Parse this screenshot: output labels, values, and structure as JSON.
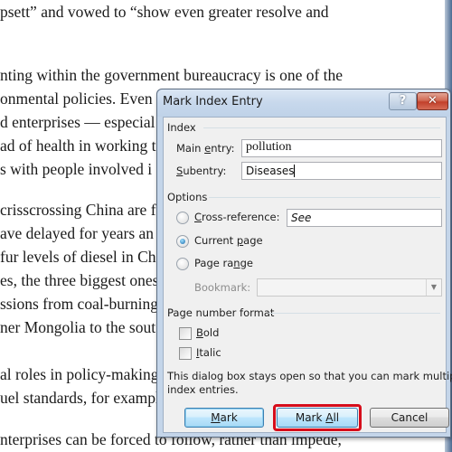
{
  "document": {
    "lines": [
      "psett” and vowed to “show even greater resolve and",
      "nting within the government bureaucracy is one of the",
      "onmental policies. Even",
      "d enterprises — especial",
      "ad of health in working t",
      "s with people involved i",
      "crisscrossing China are f",
      "ave delayed for years an",
      "fur levels of diesel in Ch",
      "es, the three biggest ones",
      "ssions from coal-burning",
      "ner Mongolia to the sout",
      "al roles in policy-making",
      "uel standards, for exampl",
      "nterprises can be forced to follow, rather than impede,"
    ]
  },
  "dialog": {
    "title": "Mark Index Entry",
    "help_button": "?",
    "close_button": "✕",
    "index_group": "Index",
    "main_entry": {
      "label_pre": "Main ",
      "label_key": "e",
      "label_post": "ntry:",
      "value": "pollution"
    },
    "subentry": {
      "label_key": "S",
      "label_post": "ubentry:",
      "value": "Diseases"
    },
    "options_group": "Options",
    "cross_reference": {
      "label_key": "C",
      "label_post": "ross-reference:",
      "value": "See",
      "selected": false
    },
    "current_page": {
      "label_pre": "Current ",
      "label_key": "p",
      "label_post": "age",
      "selected": true
    },
    "page_range": {
      "label_pre": "Page ra",
      "label_key": "n",
      "label_post": "ge",
      "selected": false
    },
    "bookmark": {
      "label": "Bookmark:",
      "value": "",
      "enabled": false
    },
    "format_group": "Page number format",
    "bold": {
      "label_key": "B",
      "label_post": "old",
      "checked": false
    },
    "italic": {
      "label_key": "I",
      "label_post": "talic",
      "checked": false
    },
    "info_text_1": "This dialog box stays open so that you can mark multiple",
    "info_text_2": "index entries.",
    "buttons": {
      "mark": {
        "label_key": "M",
        "label_post": "ark"
      },
      "mark_all": {
        "label_pre": "Mark ",
        "label_key": "A",
        "label_post": "ll"
      },
      "cancel": {
        "label": "Cancel"
      }
    },
    "highlight_color": "#d60d1b"
  }
}
